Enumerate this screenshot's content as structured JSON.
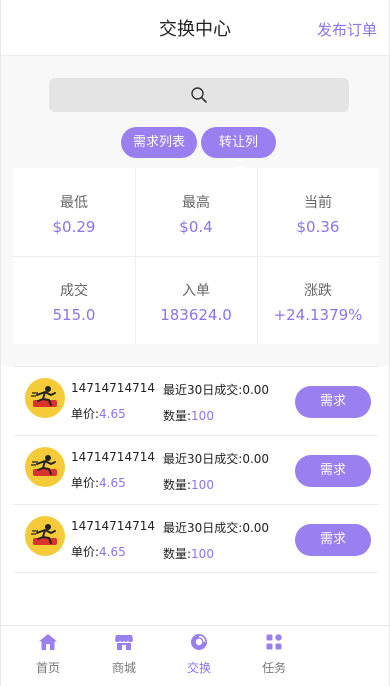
{
  "header": {
    "title": "交换中心",
    "publish_label": "发布订单"
  },
  "search": {
    "icon": "search-icon"
  },
  "filters": [
    {
      "label": "需求列表"
    },
    {
      "label": "转让列表"
    }
  ],
  "stats": [
    {
      "label": "最低",
      "value": "$0.29"
    },
    {
      "label": "最高",
      "value": "$0.4"
    },
    {
      "label": "当前",
      "value": "$0.36"
    },
    {
      "label": "成交",
      "value": "515.0"
    },
    {
      "label": "入单",
      "value": "183624.0"
    },
    {
      "label": "涨跌",
      "value": "+24.1379%"
    }
  ],
  "orders": [
    {
      "uid": "14714714714",
      "price_label": "单价:",
      "price": "4.65",
      "recent": "最近30日成交:0.00",
      "qty_label": "数量:",
      "qty": "100",
      "button": "需求"
    },
    {
      "uid": "14714714714",
      "price_label": "单价:",
      "price": "4.65",
      "recent": "最近30日成交:0.00",
      "qty_label": "数量:",
      "qty": "100",
      "button": "需求"
    },
    {
      "uid": "14714714714",
      "price_label": "单价:",
      "price": "4.65",
      "recent": "最近30日成交:0.00",
      "qty_label": "数量:",
      "qty": "100",
      "button": "需求"
    }
  ],
  "tabs": [
    {
      "label": "首页",
      "icon": "home-icon"
    },
    {
      "label": "商城",
      "icon": "store-icon"
    },
    {
      "label": "交换",
      "icon": "exchange-icon",
      "active": true
    },
    {
      "label": "任务",
      "icon": "grid-icon"
    }
  ],
  "colors": {
    "accent": "#8b74e8",
    "button": "#9a7ff0",
    "avatar_bg": "#f5cb3a"
  }
}
